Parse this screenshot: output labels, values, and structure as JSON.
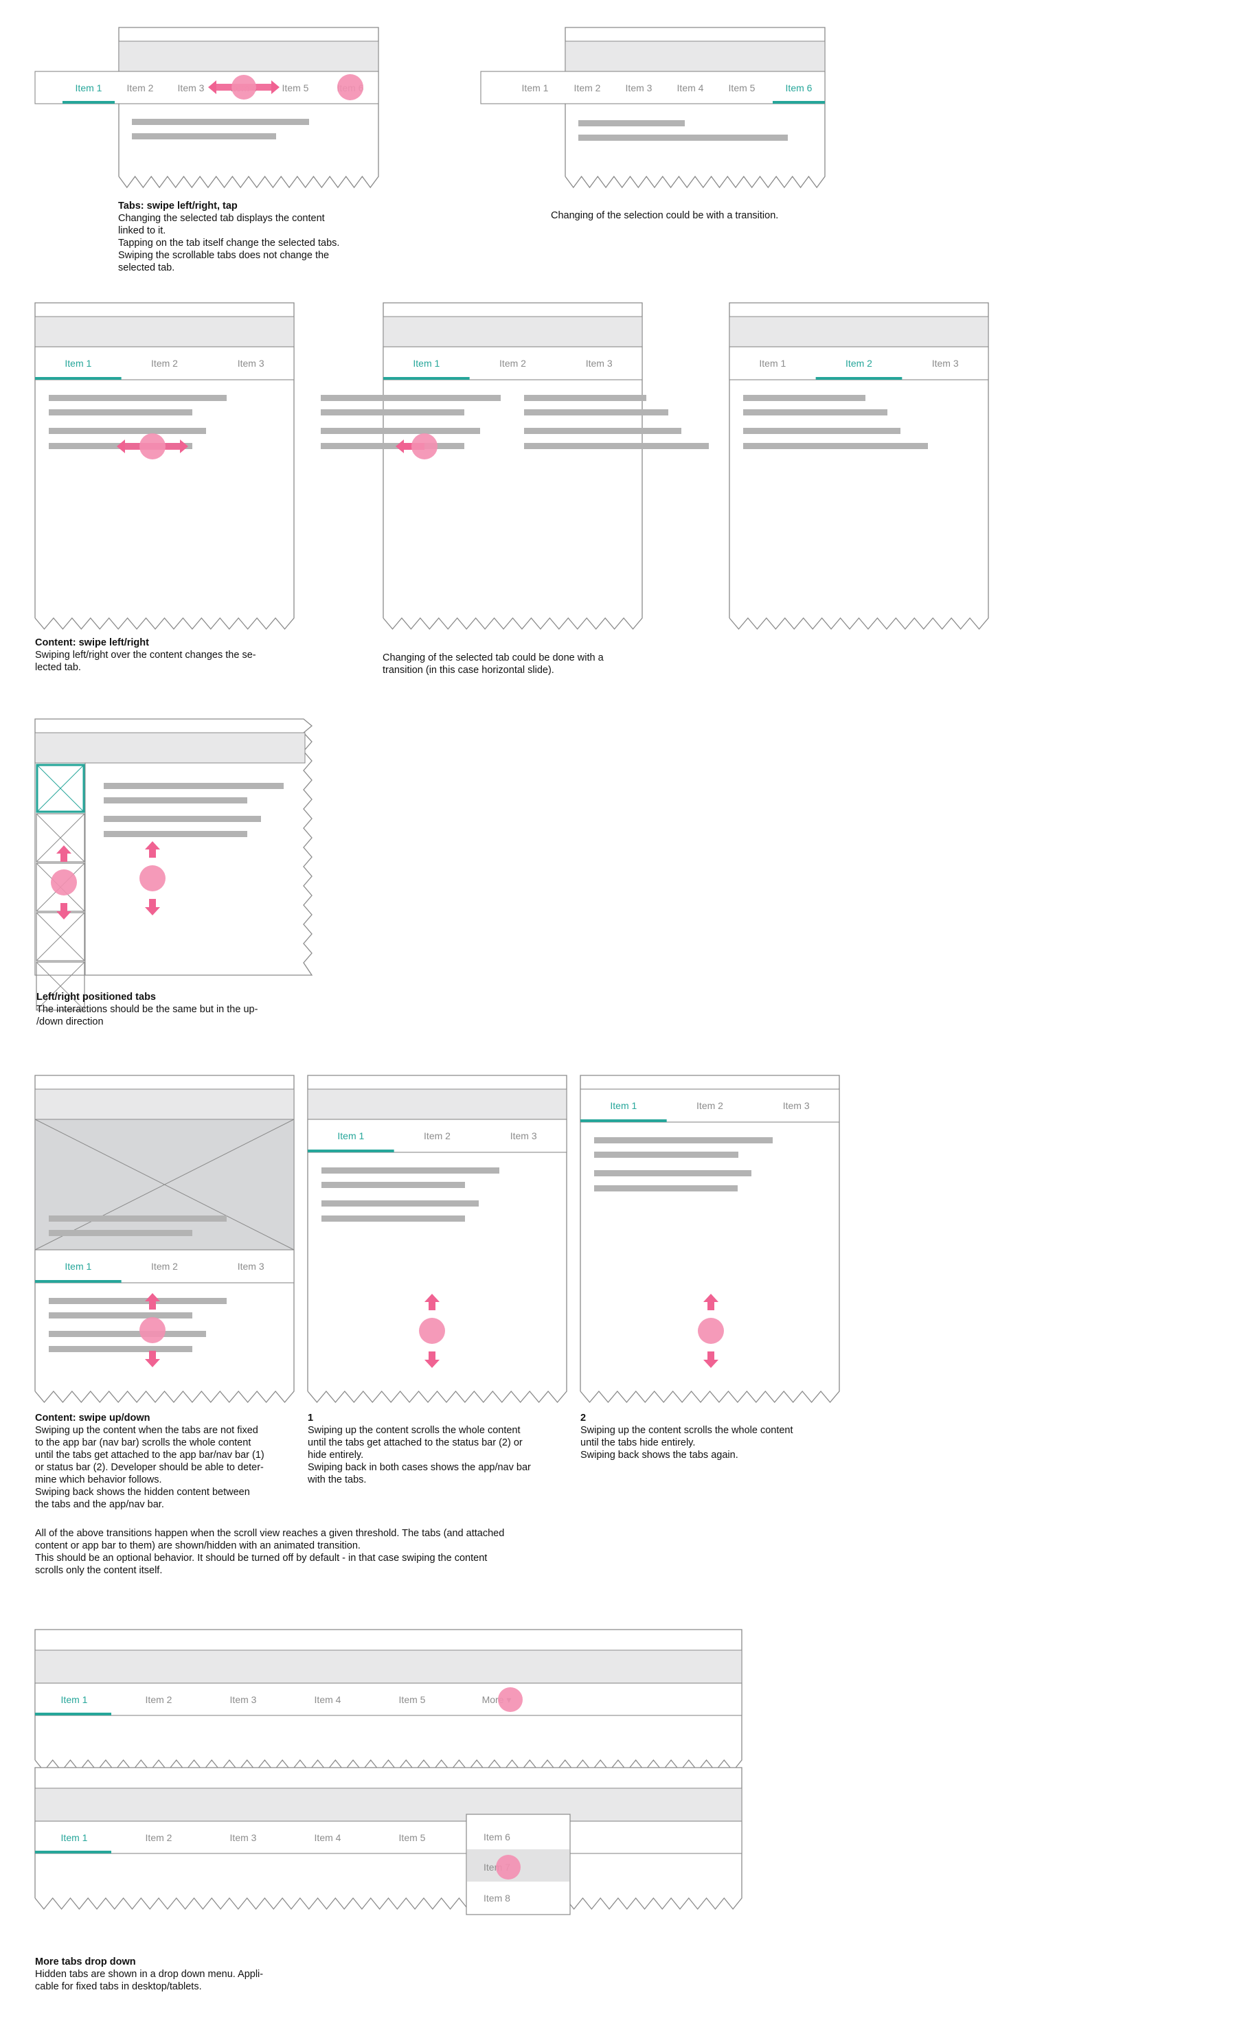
{
  "colors": {
    "accent": "#26a69a",
    "pink": "#f48fb1",
    "pinkArrow": "#f06292",
    "grayBar": "#b3b3b3",
    "panel": "#e8e8e9",
    "image": "#d6d7d9",
    "line": "#8a8a8a",
    "tabText": "#8c8c8c"
  },
  "icons": {
    "touch": "touch-point-icon",
    "arrow": "swipe-arrow-icon",
    "placeholder": "image-placeholder-icon",
    "caret": "dropdown-caret-icon"
  },
  "tabs": {
    "row6": [
      "Item 1",
      "Item 2",
      "Item 3",
      "Item 4",
      "Item 5",
      "Item 6"
    ],
    "row3": [
      "Item 1",
      "Item 2",
      "Item 3"
    ],
    "more_row": [
      "Item 1",
      "Item 2",
      "Item 3",
      "Item 4",
      "Item 5"
    ],
    "more_label": "More ▾",
    "dropdown": [
      "Item 6",
      "Item 7",
      "Item 8"
    ]
  },
  "captions": {
    "swipe_tap": {
      "title": "Tabs: swipe left/right, tap",
      "body": "Changing the selected tab displays the content\nlinked to it.\nTapping on the tab itself change the selected tabs.\nSwiping the scrollable tabs does not change the\nselected tab."
    },
    "transition": {
      "title": "",
      "body": "Changing of the selection could be with a transition."
    },
    "content_swipe": {
      "title": "Content: swipe left/right",
      "body": "Swiping left/right over the content changes the se-\nlected tab."
    },
    "slide_transition": {
      "title": "",
      "body": "Changing of the selected tab could be done with a\ntransition (in this case horizontal slide)."
    },
    "side_tabs": {
      "title": "Left/right positioned tabs",
      "body": "The interactions should be the same but in the up-\n/down direction"
    },
    "updown": {
      "title": "Content: swipe up/down",
      "body": "Swiping up the content when the tabs are not fixed\nto the app bar (nav bar) scrolls the whole content\nuntil the tabs get attached to the app bar/nav bar (1)\nor status bar (2). Developer should be able to deter-\nmine which behavior follows.\nSwiping back shows the hidden content between\nthe tabs and the app/nav bar."
    },
    "case1": {
      "title": "1",
      "body": "Swiping up the content scrolls the whole content\nuntil the tabs get attached to the status bar (2) or\nhide entirely.\nSwiping back in both cases shows the app/nav bar\nwith the tabs."
    },
    "case2": {
      "title": "2",
      "body": "Swiping up the content scrolls the whole content\nuntil the tabs hide entirely.\nSwiping back shows the tabs again."
    },
    "note": {
      "title": "",
      "body": "All of the above transitions happen when the scroll view reaches a given threshold. The tabs (and attached\ncontent or app bar to them) are shown/hidden with an animated transition.\nThis should be an optional behavior. It should be turned off by default - in that case swiping the content\nscrolls only the content itself."
    },
    "more": {
      "title": "More tabs drop down",
      "body": "Hidden tabs are shown in a drop down menu. Appli-\ncable for fixed tabs in desktop/tablets."
    }
  }
}
